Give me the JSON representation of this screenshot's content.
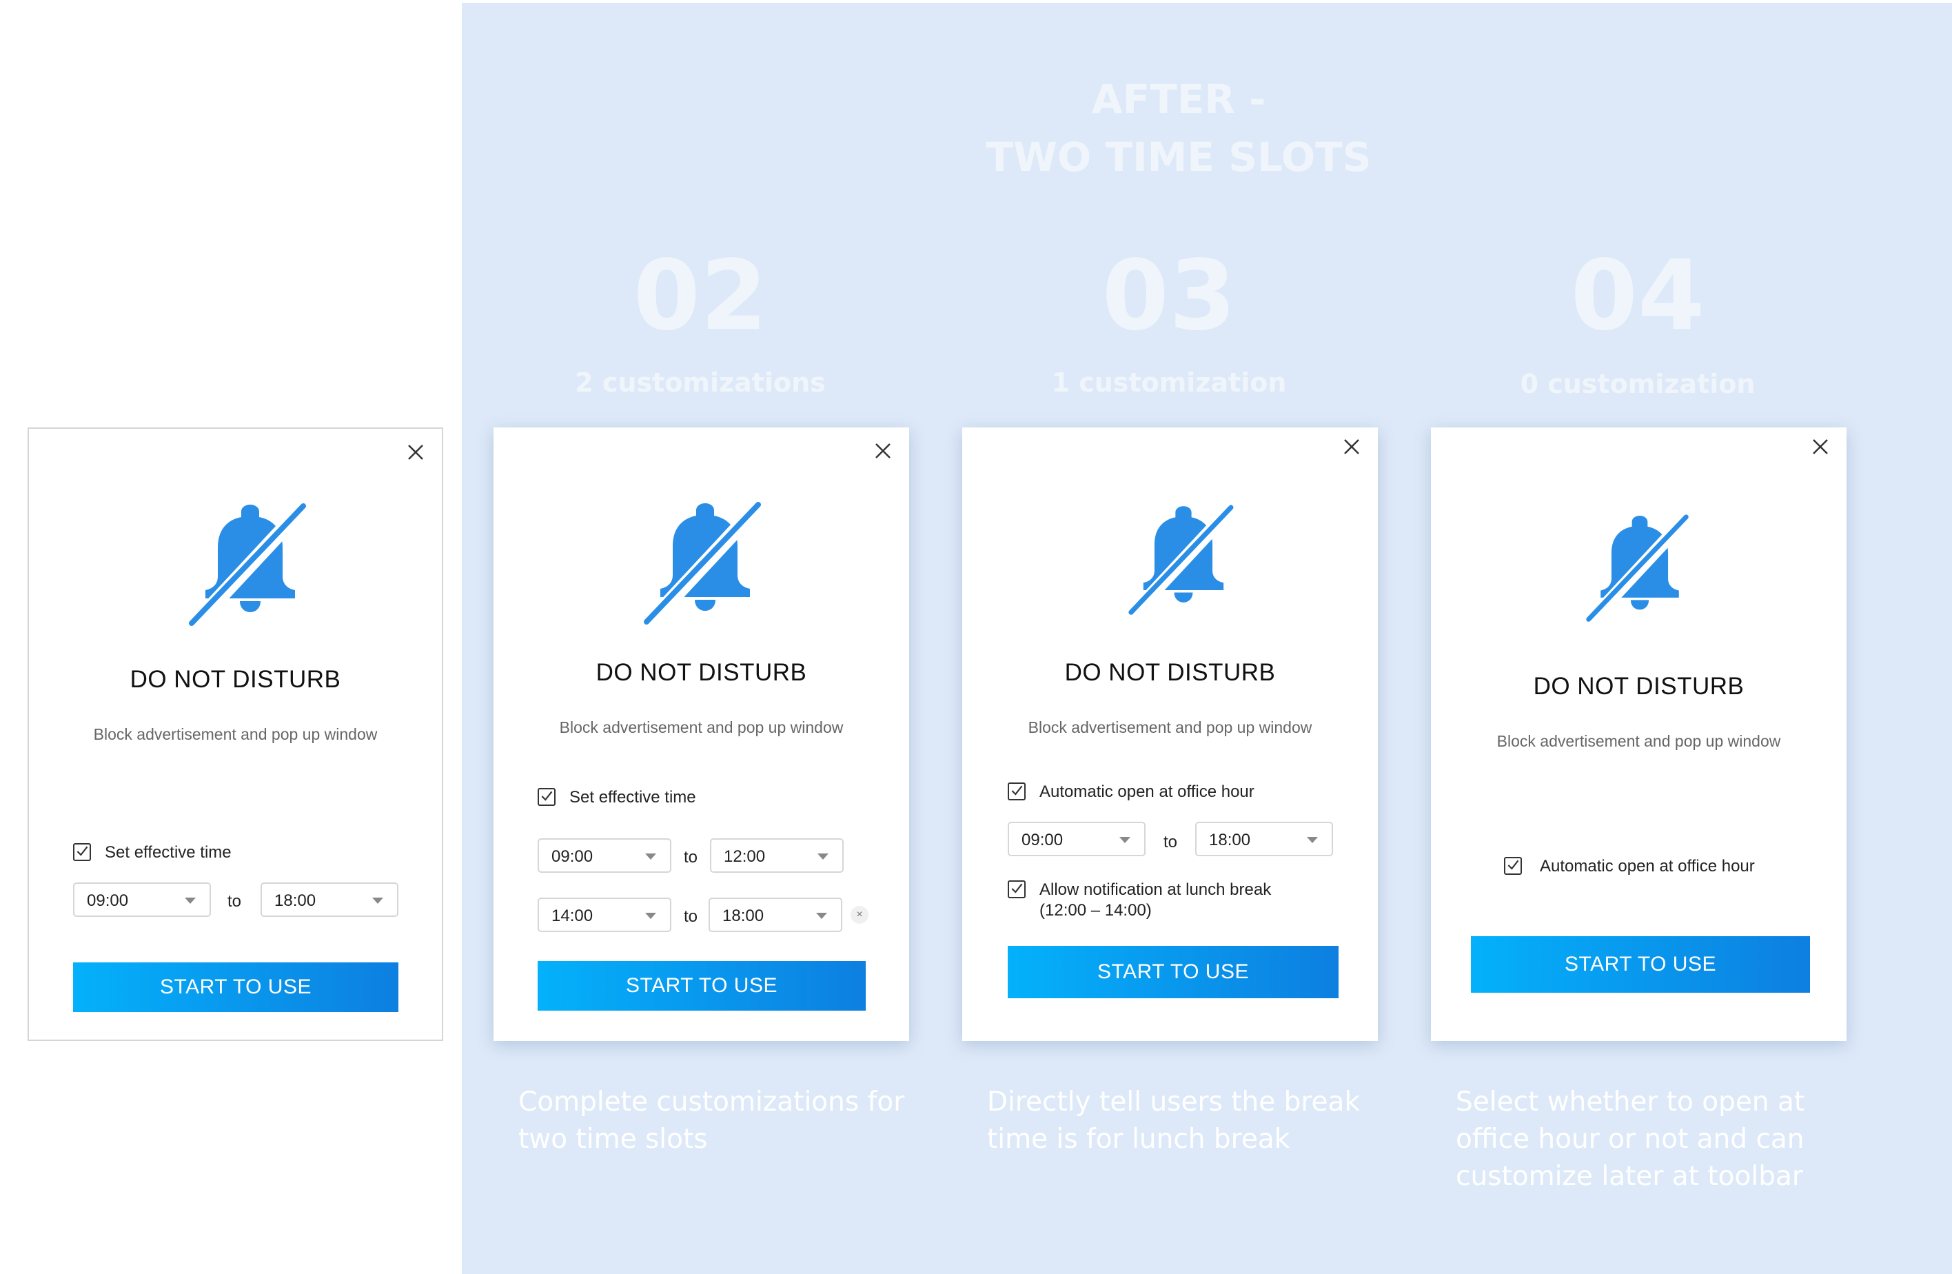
{
  "section": {
    "heading_line1": "AFTER -",
    "heading_line2": "TWO TIME SLOTS"
  },
  "steps": [
    {
      "number": "02",
      "customizations": "2 customizations",
      "caption": "Complete customizations for two time slots"
    },
    {
      "number": "03",
      "customizations": "1 customization",
      "caption": "Directly tell users the break time is for lunch break"
    },
    {
      "number": "04",
      "customizations": "0 customization",
      "caption": "Select whether to open at office hour or not and can customize later at toolbar"
    }
  ],
  "dialog": {
    "title": "DO NOT DISTURB",
    "subtitle": "Block advertisement and pop up window",
    "button": "START TO USE",
    "to_label": "to",
    "set_effective_time": "Set effective time",
    "auto_open": "Automatic open at office hour",
    "allow_lunch": "Allow notification at lunch break",
    "lunch_range": "(12:00 – 14:00)"
  },
  "times": {
    "t0900": "09:00",
    "t1200": "12:00",
    "t1400": "14:00",
    "t1800": "18:00"
  },
  "icons": {
    "bell": "bell-off-icon",
    "close": "close-icon",
    "checkbox": "check-icon",
    "remove": "remove-icon"
  },
  "remove_glyph": "×",
  "colors": {
    "accent": "#2a8ee6",
    "button_start": "#04b1fb",
    "button_end": "#0d7fe0",
    "panel_bg": "#dde9f8"
  }
}
